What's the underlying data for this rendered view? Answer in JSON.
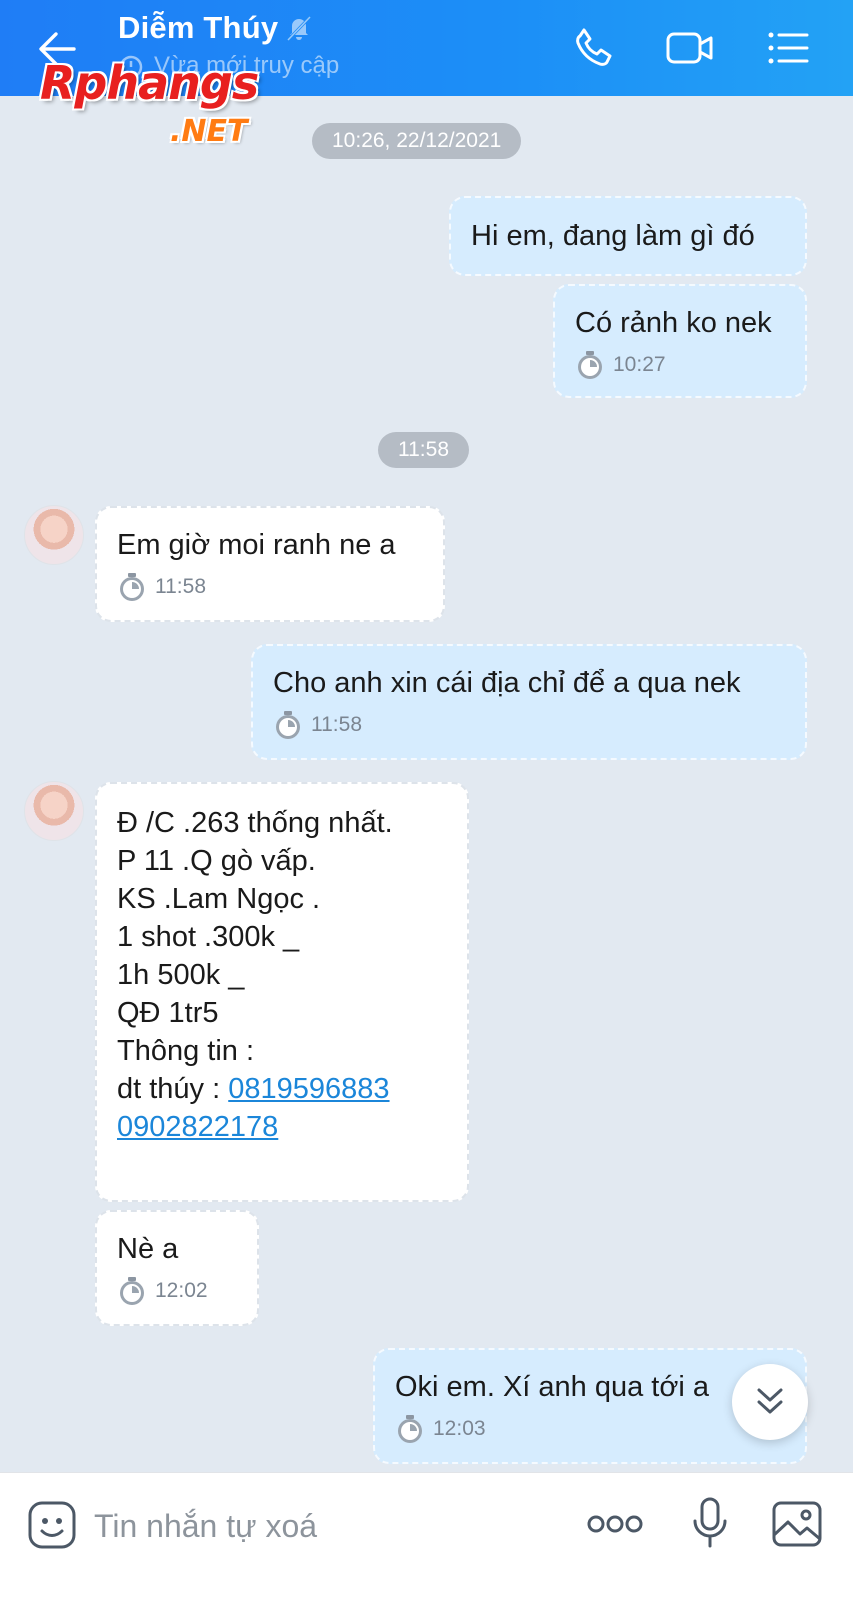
{
  "header": {
    "contact_name": "Diễm Thúy",
    "status": "Vừa mới truy cập",
    "icons": [
      "back-arrow-icon",
      "muted-bell-icon",
      "phone-icon",
      "video-call-icon",
      "menu-list-icon"
    ]
  },
  "watermark": {
    "line1": "Rphangs",
    "line2": ".NET"
  },
  "conversation": {
    "date_pill_1": "10:26, 22/12/2021",
    "date_pill_2": "11:58",
    "messages": [
      {
        "from": "me",
        "text": "Hi em, đang làm gì đó"
      },
      {
        "from": "me",
        "text": "Có rảnh ko nek",
        "time": "10:27"
      },
      {
        "from": "them",
        "text": "Em giờ moi ranh ne a",
        "time": "11:58"
      },
      {
        "from": "me",
        "text": "Cho anh xin cái địa chỉ để a qua nek",
        "time": "11:58"
      },
      {
        "from": "them",
        "text": "Đ /C .263 thống nhất.\n P 11 .Q gò vấp.\nKS  .Lam Ngọc  .\n1 shot .300k _\n1h 500k _\nQĐ 1tr5\nThông tin  :\n dt thúy  : ",
        "phone1": "0819596883",
        "phone2": "0902822178"
      },
      {
        "from": "them",
        "text": "Nè  a",
        "time": "12:02"
      },
      {
        "from": "me",
        "text": "Oki em. Xí anh qua tới a",
        "time": "12:03"
      }
    ]
  },
  "composer": {
    "placeholder": "Tin nhắn tự xoá",
    "icons": [
      "sticker-icon",
      "more-options-icon",
      "microphone-icon",
      "image-icon"
    ]
  },
  "colors": {
    "header_blue": "#1c8ff7",
    "my_bubble": "#d6ecfe",
    "background": "#e2e9f1",
    "link": "#1b86d9"
  }
}
